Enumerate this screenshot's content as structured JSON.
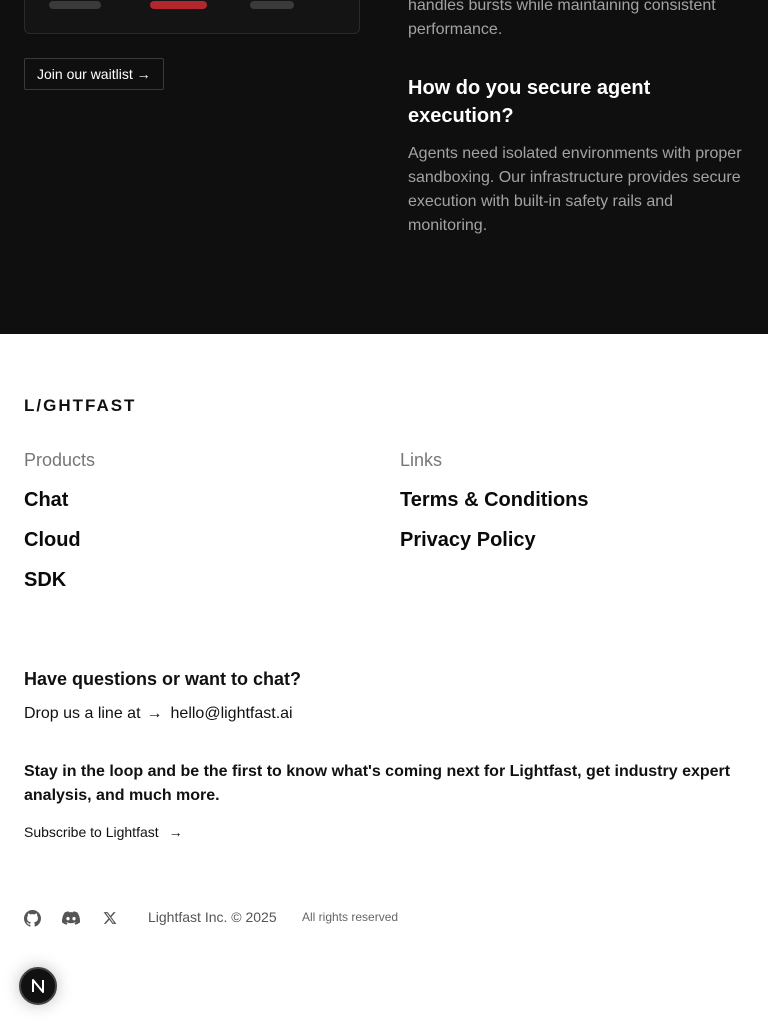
{
  "hero": {
    "waitlist_label": "Join our waitlist →",
    "prev_answer_tail": "handles bursts while maintaining consistent performance.",
    "faq_question": "How do you secure agent execution?",
    "faq_answer": "Agents need isolated environments with proper sandboxing. Our infrastructure provides secure execution with built-in safety rails and monitoring.",
    "pill_colors": [
      "#3a3a3a",
      "#b3262e",
      "#3a3a3a"
    ]
  },
  "footer": {
    "logo": "L/GHTFAST",
    "products_heading": "Products",
    "products": [
      "Chat",
      "Cloud",
      "SDK"
    ],
    "links_heading": "Links",
    "links": [
      "Terms & Conditions",
      "Privacy Policy"
    ],
    "contact_heading": "Have questions or want to chat?",
    "contact_prefix": "Drop us a line at",
    "contact_email": "hello@lightfast.ai",
    "newsletter_text": "Stay in the loop and be the first to know what's coming next for Lightfast, get industry expert analysis, and much more.",
    "subscribe_label": "Subscribe to Lightfast",
    "copyright": "Lightfast Inc. © 2025",
    "rights": "All rights reserved",
    "social_icons": [
      "github-icon",
      "discord-icon",
      "x-icon"
    ]
  },
  "badge": {
    "letter": "N"
  }
}
